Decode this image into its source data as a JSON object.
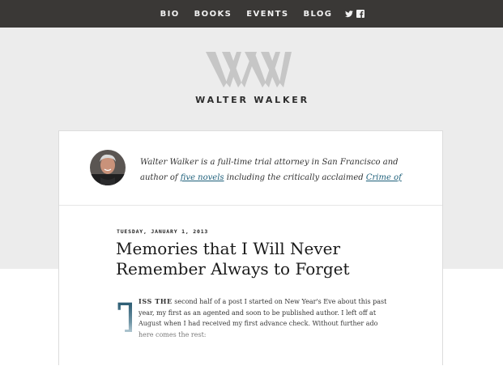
{
  "nav": {
    "items": [
      {
        "label": "BIO"
      },
      {
        "label": "BOOKS"
      },
      {
        "label": "EVENTS"
      },
      {
        "label": "BLOG"
      }
    ],
    "icons": [
      "twitter-icon",
      "facebook-icon"
    ]
  },
  "site": {
    "title": "WALTER WALKER",
    "logo_monogram": "WW"
  },
  "bio": {
    "text_start": "Walter Walker is a full-time trial attorney in San Francisco and author of ",
    "link_novels": "five novels",
    "text_mid": " including the critically acclaimed ",
    "link_book": "Crime of"
  },
  "post": {
    "date": "TUESDAY, JANUARY 1, 2013",
    "title": "Memories that I Will Never Remember Always to Forget",
    "dropcap": "T",
    "lead_smallcaps": "ISS THE",
    "body": " second half of a post I started on New Year's Eve about this past year, my first as an agented and soon to be published author. I left off at August when I had received my first advance check. Without further ado here comes the rest:"
  },
  "colors": {
    "nav_bg": "#3a3836",
    "link": "#1d5f7a",
    "background": "#ececec"
  }
}
